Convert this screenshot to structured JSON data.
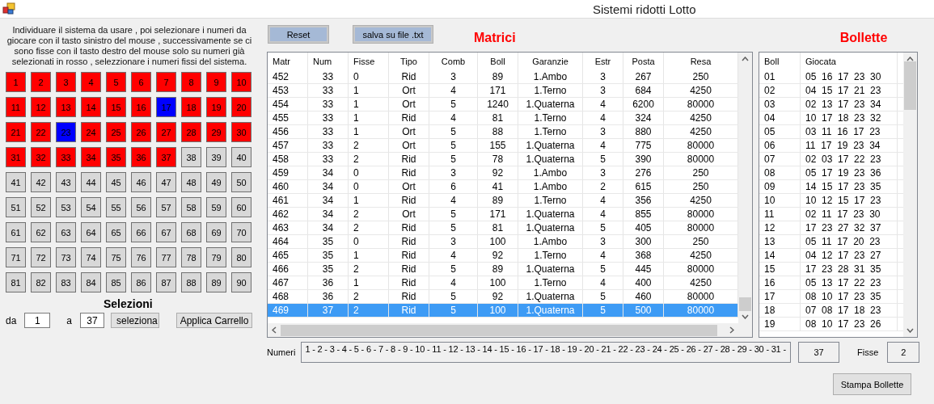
{
  "window": {
    "title": "Sistemi ridotti Lotto"
  },
  "instructions": "Individuare il sistema da usare , poi selezionare i numeri da giocare con il tasto sinistro del mouse , successivamente se ci sono fisse con il tasto destro del mouse solo su numeri già selezionati in rosso , selezzionare i numeri fissi del sistema.",
  "numbers": [
    {
      "label": "1",
      "selected": true,
      "fixed": false
    },
    {
      "label": "2",
      "selected": true,
      "fixed": false
    },
    {
      "label": "3",
      "selected": true,
      "fixed": false
    },
    {
      "label": "4",
      "selected": true,
      "fixed": false
    },
    {
      "label": "5",
      "selected": true,
      "fixed": false
    },
    {
      "label": "6",
      "selected": true,
      "fixed": false
    },
    {
      "label": "7",
      "selected": true,
      "fixed": false
    },
    {
      "label": "8",
      "selected": true,
      "fixed": false
    },
    {
      "label": "9",
      "selected": true,
      "fixed": false
    },
    {
      "label": "10",
      "selected": true,
      "fixed": false
    },
    {
      "label": "11",
      "selected": true,
      "fixed": false
    },
    {
      "label": "12",
      "selected": true,
      "fixed": false
    },
    {
      "label": "13",
      "selected": true,
      "fixed": false
    },
    {
      "label": "14",
      "selected": true,
      "fixed": false
    },
    {
      "label": "15",
      "selected": true,
      "fixed": false
    },
    {
      "label": "16",
      "selected": true,
      "fixed": false
    },
    {
      "label": "17",
      "selected": true,
      "fixed": true
    },
    {
      "label": "18",
      "selected": true,
      "fixed": false
    },
    {
      "label": "19",
      "selected": true,
      "fixed": false
    },
    {
      "label": "20",
      "selected": true,
      "fixed": false
    },
    {
      "label": "21",
      "selected": true,
      "fixed": false
    },
    {
      "label": "22",
      "selected": true,
      "fixed": false
    },
    {
      "label": "23",
      "selected": true,
      "fixed": true
    },
    {
      "label": "24",
      "selected": true,
      "fixed": false
    },
    {
      "label": "25",
      "selected": true,
      "fixed": false
    },
    {
      "label": "26",
      "selected": true,
      "fixed": false
    },
    {
      "label": "27",
      "selected": true,
      "fixed": false
    },
    {
      "label": "28",
      "selected": true,
      "fixed": false
    },
    {
      "label": "29",
      "selected": true,
      "fixed": false
    },
    {
      "label": "30",
      "selected": true,
      "fixed": false
    },
    {
      "label": "31",
      "selected": true,
      "fixed": false
    },
    {
      "label": "32",
      "selected": true,
      "fixed": false
    },
    {
      "label": "33",
      "selected": true,
      "fixed": false
    },
    {
      "label": "34",
      "selected": true,
      "fixed": false
    },
    {
      "label": "35",
      "selected": true,
      "fixed": false
    },
    {
      "label": "36",
      "selected": true,
      "fixed": false
    },
    {
      "label": "37",
      "selected": true,
      "fixed": false
    },
    {
      "label": "38",
      "selected": false,
      "fixed": false
    },
    {
      "label": "39",
      "selected": false,
      "fixed": false
    },
    {
      "label": "40",
      "selected": false,
      "fixed": false
    },
    {
      "label": "41",
      "selected": false,
      "fixed": false
    },
    {
      "label": "42",
      "selected": false,
      "fixed": false
    },
    {
      "label": "43",
      "selected": false,
      "fixed": false
    },
    {
      "label": "44",
      "selected": false,
      "fixed": false
    },
    {
      "label": "45",
      "selected": false,
      "fixed": false
    },
    {
      "label": "46",
      "selected": false,
      "fixed": false
    },
    {
      "label": "47",
      "selected": false,
      "fixed": false
    },
    {
      "label": "48",
      "selected": false,
      "fixed": false
    },
    {
      "label": "49",
      "selected": false,
      "fixed": false
    },
    {
      "label": "50",
      "selected": false,
      "fixed": false
    },
    {
      "label": "51",
      "selected": false,
      "fixed": false
    },
    {
      "label": "52",
      "selected": false,
      "fixed": false
    },
    {
      "label": "53",
      "selected": false,
      "fixed": false
    },
    {
      "label": "54",
      "selected": false,
      "fixed": false
    },
    {
      "label": "55",
      "selected": false,
      "fixed": false
    },
    {
      "label": "56",
      "selected": false,
      "fixed": false
    },
    {
      "label": "57",
      "selected": false,
      "fixed": false
    },
    {
      "label": "58",
      "selected": false,
      "fixed": false
    },
    {
      "label": "59",
      "selected": false,
      "fixed": false
    },
    {
      "label": "60",
      "selected": false,
      "fixed": false
    },
    {
      "label": "61",
      "selected": false,
      "fixed": false
    },
    {
      "label": "62",
      "selected": false,
      "fixed": false
    },
    {
      "label": "63",
      "selected": false,
      "fixed": false
    },
    {
      "label": "64",
      "selected": false,
      "fixed": false
    },
    {
      "label": "65",
      "selected": false,
      "fixed": false
    },
    {
      "label": "66",
      "selected": false,
      "fixed": false
    },
    {
      "label": "67",
      "selected": false,
      "fixed": false
    },
    {
      "label": "68",
      "selected": false,
      "fixed": false
    },
    {
      "label": "69",
      "selected": false,
      "fixed": false
    },
    {
      "label": "70",
      "selected": false,
      "fixed": false
    },
    {
      "label": "71",
      "selected": false,
      "fixed": false
    },
    {
      "label": "72",
      "selected": false,
      "fixed": false
    },
    {
      "label": "73",
      "selected": false,
      "fixed": false
    },
    {
      "label": "74",
      "selected": false,
      "fixed": false
    },
    {
      "label": "75",
      "selected": false,
      "fixed": false
    },
    {
      "label": "76",
      "selected": false,
      "fixed": false
    },
    {
      "label": "77",
      "selected": false,
      "fixed": false
    },
    {
      "label": "78",
      "selected": false,
      "fixed": false
    },
    {
      "label": "79",
      "selected": false,
      "fixed": false
    },
    {
      "label": "80",
      "selected": false,
      "fixed": false
    },
    {
      "label": "81",
      "selected": false,
      "fixed": false
    },
    {
      "label": "82",
      "selected": false,
      "fixed": false
    },
    {
      "label": "83",
      "selected": false,
      "fixed": false
    },
    {
      "label": "84",
      "selected": false,
      "fixed": false
    },
    {
      "label": "85",
      "selected": false,
      "fixed": false
    },
    {
      "label": "86",
      "selected": false,
      "fixed": false
    },
    {
      "label": "87",
      "selected": false,
      "fixed": false
    },
    {
      "label": "88",
      "selected": false,
      "fixed": false
    },
    {
      "label": "89",
      "selected": false,
      "fixed": false
    },
    {
      "label": "90",
      "selected": false,
      "fixed": false
    }
  ],
  "selezioni": {
    "title": "Selezioni",
    "from_label": "da",
    "from_value": "1",
    "to_label": "a",
    "to_value": "37",
    "select_button": "seleziona",
    "apply_button": "Applica Carrello"
  },
  "toolbar": {
    "reset_button": "Reset",
    "save_button": "salva su file .txt"
  },
  "matrici": {
    "title": "Matrici",
    "columns": [
      "Matr",
      "Num",
      "Fisse",
      "Tipo",
      "Comb",
      "Boll",
      "Garanzie",
      "Estr",
      "Posta",
      "Resa"
    ],
    "rows": [
      {
        "cells": [
          "452",
          "33",
          "0",
          "Rid",
          "3",
          "89",
          "1.Ambo",
          "3",
          "267",
          "250"
        ],
        "selected": false
      },
      {
        "cells": [
          "453",
          "33",
          "1",
          "Ort",
          "4",
          "171",
          "1.Terno",
          "3",
          "684",
          "4250"
        ],
        "selected": false
      },
      {
        "cells": [
          "454",
          "33",
          "1",
          "Ort",
          "5",
          "1240",
          "1.Quaterna",
          "4",
          "6200",
          "80000"
        ],
        "selected": false
      },
      {
        "cells": [
          "455",
          "33",
          "1",
          "Rid",
          "4",
          "81",
          "1.Terno",
          "4",
          "324",
          "4250"
        ],
        "selected": false
      },
      {
        "cells": [
          "456",
          "33",
          "1",
          "Ort",
          "5",
          "88",
          "1.Terno",
          "3",
          "880",
          "4250"
        ],
        "selected": false
      },
      {
        "cells": [
          "457",
          "33",
          "2",
          "Ort",
          "5",
          "155",
          "1.Quaterna",
          "4",
          "775",
          "80000"
        ],
        "selected": false
      },
      {
        "cells": [
          "458",
          "33",
          "2",
          "Rid",
          "5",
          "78",
          "1.Quaterna",
          "5",
          "390",
          "80000"
        ],
        "selected": false
      },
      {
        "cells": [
          "459",
          "34",
          "0",
          "Rid",
          "3",
          "92",
          "1.Ambo",
          "3",
          "276",
          "250"
        ],
        "selected": false
      },
      {
        "cells": [
          "460",
          "34",
          "0",
          "Ort",
          "6",
          "41",
          "1.Ambo",
          "2",
          "615",
          "250"
        ],
        "selected": false
      },
      {
        "cells": [
          "461",
          "34",
          "1",
          "Rid",
          "4",
          "89",
          "1.Terno",
          "4",
          "356",
          "4250"
        ],
        "selected": false
      },
      {
        "cells": [
          "462",
          "34",
          "2",
          "Ort",
          "5",
          "171",
          "1.Quaterna",
          "4",
          "855",
          "80000"
        ],
        "selected": false
      },
      {
        "cells": [
          "463",
          "34",
          "2",
          "Rid",
          "5",
          "81",
          "1.Quaterna",
          "5",
          "405",
          "80000"
        ],
        "selected": false
      },
      {
        "cells": [
          "464",
          "35",
          "0",
          "Rid",
          "3",
          "100",
          "1.Ambo",
          "3",
          "300",
          "250"
        ],
        "selected": false
      },
      {
        "cells": [
          "465",
          "35",
          "1",
          "Rid",
          "4",
          "92",
          "1.Terno",
          "4",
          "368",
          "4250"
        ],
        "selected": false
      },
      {
        "cells": [
          "466",
          "35",
          "2",
          "Rid",
          "5",
          "89",
          "1.Quaterna",
          "5",
          "445",
          "80000"
        ],
        "selected": false
      },
      {
        "cells": [
          "467",
          "36",
          "1",
          "Rid",
          "4",
          "100",
          "1.Terno",
          "4",
          "400",
          "4250"
        ],
        "selected": false
      },
      {
        "cells": [
          "468",
          "36",
          "2",
          "Rid",
          "5",
          "92",
          "1.Quaterna",
          "5",
          "460",
          "80000"
        ],
        "selected": false
      },
      {
        "cells": [
          "469",
          "37",
          "2",
          "Rid",
          "5",
          "100",
          "1.Quaterna",
          "5",
          "500",
          "80000"
        ],
        "selected": true
      }
    ]
  },
  "bollette": {
    "title": "Bollette",
    "columns": [
      "Boll",
      "Giocata"
    ],
    "rows": [
      [
        "01",
        "05  16  17  23  30"
      ],
      [
        "02",
        "04  15  17  21  23"
      ],
      [
        "03",
        "02  13  17  23  34"
      ],
      [
        "04",
        "10  17  18  23  32"
      ],
      [
        "05",
        "03  11  16  17  23"
      ],
      [
        "06",
        "11  17  19  23  34"
      ],
      [
        "07",
        "02  03  17  22  23"
      ],
      [
        "08",
        "05  17  19  23  36"
      ],
      [
        "09",
        "14  15  17  23  35"
      ],
      [
        "10",
        "10  12  15  17  23"
      ],
      [
        "11",
        "02  11  17  23  30"
      ],
      [
        "12",
        "17  23  27  32  37"
      ],
      [
        "13",
        "05  11  17  20  23"
      ],
      [
        "14",
        "04  12  17  23  27"
      ],
      [
        "15",
        "17  23  28  31  35"
      ],
      [
        "16",
        "05  13  17  22  23"
      ],
      [
        "17",
        "08  10  17  23  35"
      ],
      [
        "18",
        "07  08  17  18  23"
      ],
      [
        "19",
        "08  10  17  23  26"
      ]
    ]
  },
  "footer": {
    "numbers_label": "Numeri",
    "numbers_value": "1 - 2 - 3 - 4 - 5 - 6 - 7 - 8 - 9 - 10 - 11 - 12 - 13 - 14 - 15 - 16 - 17 - 18 - 19 - 20 - 21 - 22 - 23 - 24 - 25 - 26 - 27 - 28 - 29 - 30 - 31 -",
    "count_value": "37",
    "fisse_label": "Fisse",
    "fisse_value": "2",
    "print_button": "Stampa Bollette"
  }
}
